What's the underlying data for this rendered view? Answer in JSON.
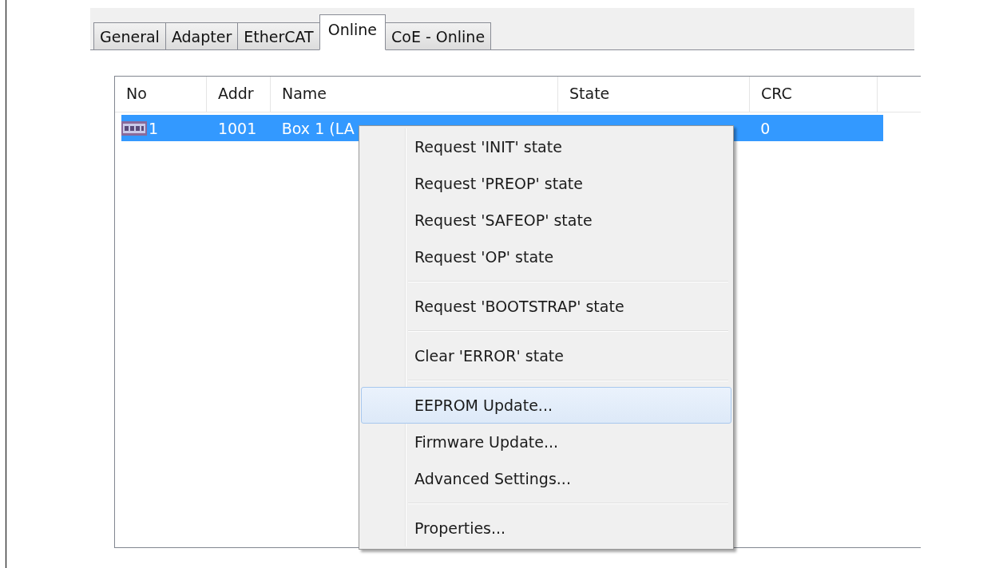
{
  "tabs": [
    {
      "label": "General",
      "selected": false
    },
    {
      "label": "Adapter",
      "selected": false
    },
    {
      "label": "EtherCAT",
      "selected": false
    },
    {
      "label": "Online",
      "selected": true
    },
    {
      "label": "CoE - Online",
      "selected": false
    }
  ],
  "table": {
    "columns": [
      "No",
      "Addr",
      "Name",
      "State",
      "CRC"
    ],
    "rows": [
      {
        "selected": true,
        "cells": [
          "1",
          "1001",
          "Box 1 (LA",
          "",
          "0"
        ]
      }
    ]
  },
  "context_menu": {
    "items": [
      {
        "kind": "item",
        "label": "Request 'INIT' state",
        "selected": false
      },
      {
        "kind": "item",
        "label": "Request 'PREOP' state",
        "selected": false
      },
      {
        "kind": "item",
        "label": "Request 'SAFEOP' state",
        "selected": false
      },
      {
        "kind": "item",
        "label": "Request 'OP' state",
        "selected": false
      },
      {
        "kind": "separator"
      },
      {
        "kind": "item",
        "label": "Request 'BOOTSTRAP' state",
        "selected": false
      },
      {
        "kind": "separator"
      },
      {
        "kind": "item",
        "label": "Clear 'ERROR' state",
        "selected": false
      },
      {
        "kind": "separator"
      },
      {
        "kind": "item",
        "label": "EEPROM Update...",
        "selected": true
      },
      {
        "kind": "item",
        "label": "Firmware Update...",
        "selected": false
      },
      {
        "kind": "item",
        "label": "Advanced Settings...",
        "selected": false
      },
      {
        "kind": "separator"
      },
      {
        "kind": "item",
        "label": "Properties...",
        "selected": false
      }
    ]
  }
}
